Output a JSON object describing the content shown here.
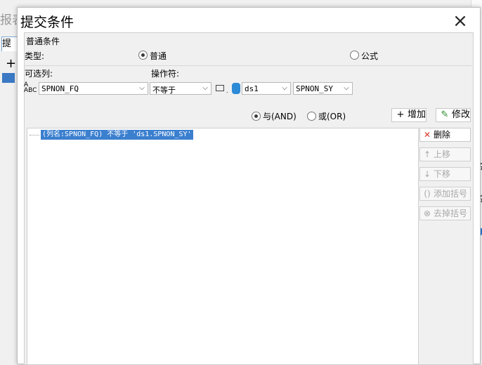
{
  "background": {
    "title_fragment": "报表",
    "tab_fragment": "提交",
    "right_fragments": [
      "名",
      "名"
    ]
  },
  "dialog": {
    "title": "提交条件",
    "group_title": "普通条件",
    "type_label": "类型:",
    "type_options": [
      {
        "label": "普通",
        "selected": true
      },
      {
        "label": "公式",
        "selected": false
      }
    ],
    "column_label": "可选列:",
    "operator_label": "操作符:",
    "column_value": "SPNON_FQ",
    "operator_value": "不等于",
    "dataset_value": "ds1",
    "field_value": "SPNON_SY",
    "logic_options": [
      {
        "label": "与(AND)",
        "selected": true
      },
      {
        "label": "或(OR)",
        "selected": false
      }
    ],
    "add_button": "增加",
    "modify_button": "修改",
    "conditions": [
      "(列名:SPNON_FQ) 不等于 'ds1.SPNON_SY'"
    ],
    "side_buttons": {
      "delete": "删除",
      "move_up": "上移",
      "move_down": "下移",
      "add_bracket": "添加括号",
      "remove_bracket": "去掉括号"
    }
  }
}
